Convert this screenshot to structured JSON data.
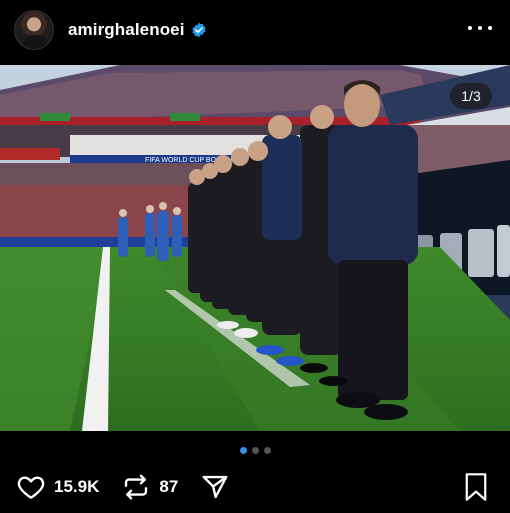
{
  "post": {
    "username": "amirghalenoei",
    "verified": true,
    "icons": {
      "avatar": "profile-avatar",
      "verified": "verified-badge-icon",
      "more": "more-options-icon",
      "like": "heart-icon",
      "repost": "repost-icon",
      "share": "send-icon",
      "save": "bookmark-icon"
    },
    "carousel": {
      "counter": "1/3",
      "current": 1,
      "total": 3
    },
    "photo": {
      "stadium_banner": "FIFA WORLD CUP BOSTON"
    },
    "stats": {
      "likes": "15.9K",
      "reposts": "87"
    }
  },
  "colors": {
    "background": "#000000",
    "accent_blue": "#3c8ef0",
    "verified_blue": "#1d9bf0"
  }
}
